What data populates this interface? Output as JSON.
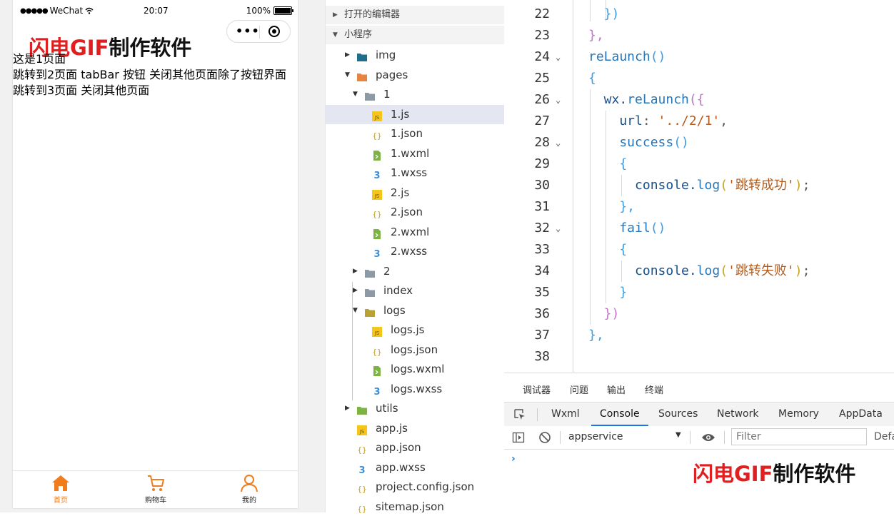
{
  "phone": {
    "status_bar": {
      "signal_dots": "●●●●●",
      "carrier": "WeChat",
      "time": "20:07",
      "battery_text": "100%",
      "battery_level": 1.0
    },
    "watermark": {
      "red_part": "闪电GIF",
      "black_part": "制作软件"
    },
    "content": {
      "line1": "这是1页面",
      "line2": "跳转到2页面 tabBar 按钮 关闭其他页面除了按钮界面",
      "line3": "跳转到3页面 关闭其他页面"
    },
    "tabbar": {
      "items": [
        {
          "label": "首页",
          "icon": "home-icon",
          "active": true
        },
        {
          "label": "购物车",
          "icon": "cart-icon",
          "active": false
        },
        {
          "label": "我的",
          "icon": "user-icon",
          "active": false
        }
      ],
      "active_color": "#f07c1c"
    }
  },
  "explorer": {
    "open_editors_label": "打开的编辑器",
    "project_label": "小程序",
    "tree": [
      {
        "name": "img",
        "type": "folder",
        "expanded": false
      },
      {
        "name": "pages",
        "type": "folder",
        "expanded": true
      },
      {
        "name": "1",
        "type": "folder",
        "expanded": true
      },
      {
        "name": "1.js",
        "type": "js",
        "selected": true
      },
      {
        "name": "1.json",
        "type": "json"
      },
      {
        "name": "1.wxml",
        "type": "wxml"
      },
      {
        "name": "1.wxss",
        "type": "wxss"
      },
      {
        "name": "2.js",
        "type": "js"
      },
      {
        "name": "2.json",
        "type": "json"
      },
      {
        "name": "2.wxml",
        "type": "wxml"
      },
      {
        "name": "2.wxss",
        "type": "wxss"
      },
      {
        "name": "2",
        "type": "folder",
        "expanded": false
      },
      {
        "name": "index",
        "type": "folder",
        "expanded": false
      },
      {
        "name": "logs",
        "type": "folder",
        "expanded": true
      },
      {
        "name": "logs.js",
        "type": "js"
      },
      {
        "name": "logs.json",
        "type": "json"
      },
      {
        "name": "logs.wxml",
        "type": "wxml"
      },
      {
        "name": "logs.wxss",
        "type": "wxss"
      },
      {
        "name": "utils",
        "type": "folder",
        "expanded": false
      },
      {
        "name": "app.js",
        "type": "js"
      },
      {
        "name": "app.json",
        "type": "json"
      },
      {
        "name": "app.wxss",
        "type": "wxss"
      },
      {
        "name": "project.config.json",
        "type": "json"
      },
      {
        "name": "sitemap.json",
        "type": "json"
      }
    ]
  },
  "editor": {
    "lines": [
      {
        "n": "22",
        "fold": false,
        "code": [
          [
            "  ",
            ""
          ],
          [
            "})",
            "tk-brace2"
          ]
        ]
      },
      {
        "n": "23",
        "fold": false,
        "code": [
          [
            "},",
            "tk-brace1"
          ]
        ]
      },
      {
        "n": "24",
        "fold": true,
        "code": [
          [
            "reLaunch",
            "tk-fn"
          ],
          [
            "()",
            "tk-brace2"
          ]
        ]
      },
      {
        "n": "25",
        "fold": false,
        "code": [
          [
            "{",
            "tk-brace2"
          ]
        ]
      },
      {
        "n": "26",
        "fold": true,
        "code": [
          [
            "  wx.",
            "tk-prop"
          ],
          [
            "reLaunch",
            "tk-fn"
          ],
          [
            "({",
            "tk-brace1"
          ]
        ]
      },
      {
        "n": "27",
        "fold": false,
        "code": [
          [
            "    url",
            "tk-prop"
          ],
          [
            ": ",
            "tk-punc"
          ],
          [
            "'../2/1'",
            "tk-str"
          ],
          [
            ",",
            "tk-punc"
          ]
        ]
      },
      {
        "n": "28",
        "fold": true,
        "code": [
          [
            "    success",
            "tk-fn"
          ],
          [
            "()",
            "tk-brace2"
          ]
        ]
      },
      {
        "n": "29",
        "fold": false,
        "code": [
          [
            "    {",
            "tk-brace2"
          ]
        ]
      },
      {
        "n": "30",
        "fold": false,
        "code": [
          [
            "      console.",
            "tk-prop"
          ],
          [
            "log",
            "tk-fn"
          ],
          [
            "(",
            "tk-brace3"
          ],
          [
            "'跳转成功'",
            "tk-str"
          ],
          [
            ")",
            "tk-brace3"
          ],
          [
            ";",
            "tk-punc"
          ]
        ]
      },
      {
        "n": "31",
        "fold": false,
        "code": [
          [
            "    },",
            "tk-brace2"
          ]
        ]
      },
      {
        "n": "32",
        "fold": true,
        "code": [
          [
            "    fail",
            "tk-fn"
          ],
          [
            "()",
            "tk-brace2"
          ]
        ]
      },
      {
        "n": "33",
        "fold": false,
        "code": [
          [
            "    {",
            "tk-brace2"
          ]
        ]
      },
      {
        "n": "34",
        "fold": false,
        "code": [
          [
            "      console.",
            "tk-prop"
          ],
          [
            "log",
            "tk-fn"
          ],
          [
            "(",
            "tk-brace3"
          ],
          [
            "'跳转失败'",
            "tk-str"
          ],
          [
            ")",
            "tk-brace3"
          ],
          [
            ";",
            "tk-punc"
          ]
        ]
      },
      {
        "n": "35",
        "fold": false,
        "code": [
          [
            "    }",
            "tk-brace2"
          ]
        ]
      },
      {
        "n": "36",
        "fold": false,
        "code": [
          [
            "  })",
            "tk-brace1"
          ]
        ]
      },
      {
        "n": "37",
        "fold": false,
        "code": [
          [
            "},",
            "tk-brace2"
          ]
        ]
      },
      {
        "n": "38",
        "fold": false,
        "code": [
          [
            "",
            ""
          ]
        ]
      }
    ]
  },
  "debugger": {
    "panel_tabs": [
      "调试器",
      "问题",
      "输出",
      "终端"
    ],
    "devtools_tabs": [
      "Wxml",
      "Console",
      "Sources",
      "Network",
      "Memory",
      "AppData"
    ],
    "active_devtools_tab": "Console",
    "context": "appservice",
    "filter_placeholder": "Filter",
    "levels_label": "Defa",
    "prompt": "›"
  }
}
